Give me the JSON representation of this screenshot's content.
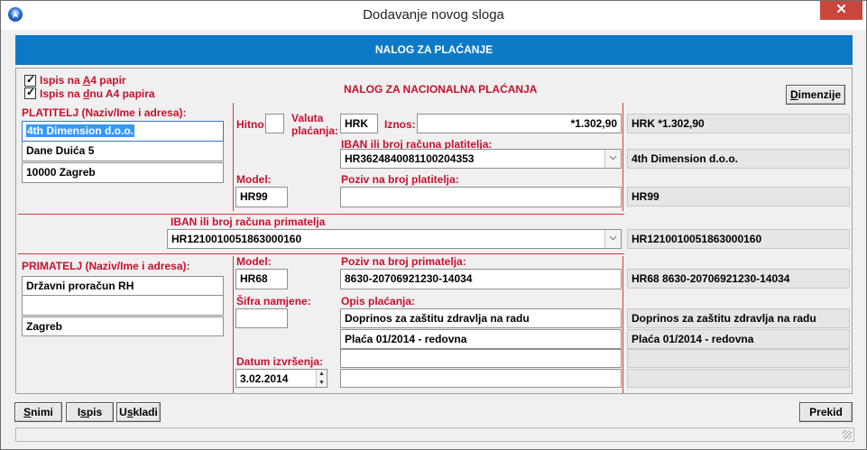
{
  "window": {
    "title": "Dodavanje novog sloga",
    "close": "✕"
  },
  "banner": "NALOG ZA PLAĆANJE",
  "options": {
    "a4_paper_pre": "Ispis na ",
    "a4_paper_u": "A",
    "a4_paper_post": "4 papir",
    "a4_bottom_pre": "Ispis na ",
    "a4_bottom_u": "d",
    "a4_bottom_post": "nu A4 papira"
  },
  "form_title": "NALOG ZA NACIONALNA PLAĆANJA",
  "dimensions_button": {
    "u": "D",
    "rest": "imenzije"
  },
  "payer": {
    "label": "PLATITELJ (Naziv/Ime i adresa):",
    "name": "4th Dimension d.o.o.",
    "street": "Dane Duića 5",
    "city": "10000 Zagreb"
  },
  "urgent_label": "Hitno:",
  "currency_label_1": "Valuta",
  "currency_label_2": "plaćanja:",
  "currency": "HRK",
  "amount_label": "Iznos:",
  "amount": "*1.302,90",
  "payer_iban_label": "IBAN ili broj računa platitelja:",
  "payer_iban": "HR3624840081100204353",
  "model_label": "Model:",
  "payer_model": "HR99",
  "payer_ref_label": "Poziv na broj platitelja:",
  "payer_ref": "",
  "recipient_iban_label": "IBAN ili broj računa primatelja",
  "recipient_iban": "HR1210010051863000160",
  "recipient": {
    "label": "PRIMATELJ (Naziv/Ime i adresa):",
    "name": "Državni proračun RH",
    "street": "",
    "city": "Zagreb"
  },
  "recipient_model_label": "Model:",
  "recipient_model": "HR68",
  "recipient_ref_label": "Poziv na broj primatelja:",
  "recipient_ref": "8630-20706921230-14034",
  "purpose_code_label": "Šifra namjene:",
  "purpose_code": "",
  "description_label": "Opis plaćanja:",
  "description": [
    "Doprinos za zaštitu zdravlja na radu",
    "Plaća 01/2014 - redovna",
    "",
    ""
  ],
  "execution_date_label": "Datum izvršenja:",
  "execution_date": "3.02.2014",
  "preview": {
    "amount": "HRK *1.302,90",
    "payer": "4th Dimension d.o.o.",
    "payer_model": "HR99",
    "recipient_iban": "HR1210010051863000160",
    "recipient_ref": "HR68 8630-20706921230-14034",
    "desc1": "Doprinos za zaštitu zdravlja na radu",
    "desc2": "Plaća 01/2014 - redovna",
    "desc3": "",
    "desc4": ""
  },
  "buttons": {
    "save_u": "S",
    "save_rest": "nimi",
    "print_pre": "I",
    "print_u": "s",
    "print_rest": "pis",
    "sync_pre": "U",
    "sync_u": "s",
    "sync_rest": "kladi",
    "cancel": "Prekid"
  }
}
